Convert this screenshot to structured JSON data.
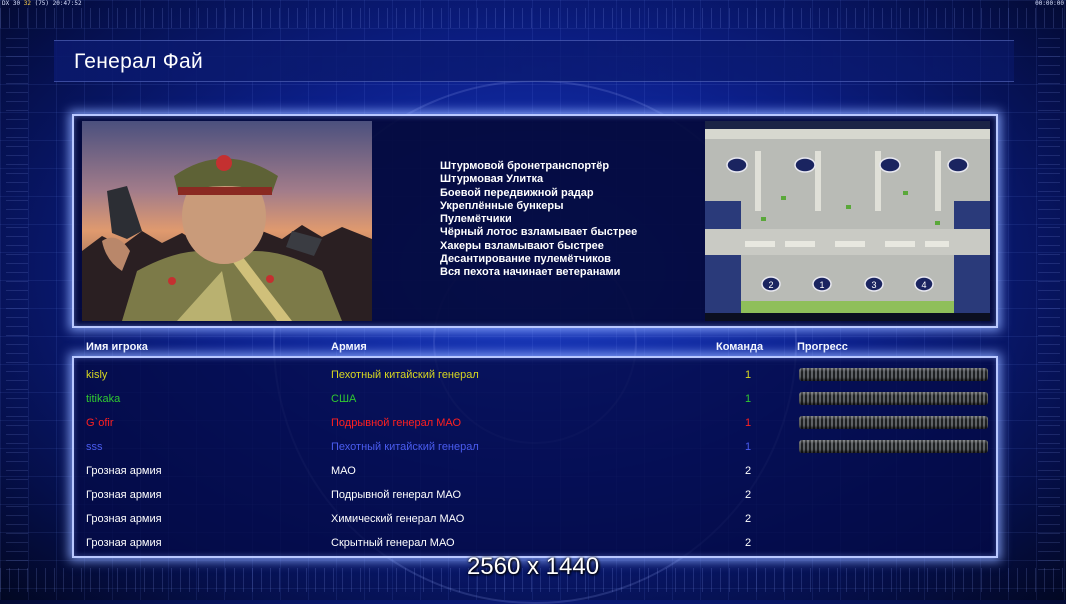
{
  "status_bar": {
    "left_a": "DX",
    "left_b": "30",
    "left_mid": "32",
    "left_c": "(75)",
    "left_time": "20:47:52",
    "right_time": "00:00:00"
  },
  "title": "Генерал Фай",
  "units": [
    "Штурмовой бронетранспортёр",
    "Штурмовая Улитка",
    "Боевой передвижной радар",
    "Укреплённые бункеры",
    "Пулемётчики",
    "Чёрный лотос взламывает быстрее",
    "Хакеры взламывают быстрее",
    "Десантирование пулемётчиков",
    "Вся пехота начинает ветеранами"
  ],
  "minimap": {
    "start_positions": [
      "2",
      "1",
      "3",
      "4"
    ]
  },
  "table": {
    "headers": {
      "player": "Имя игрока",
      "army": "Армия",
      "team": "Команда",
      "progress": "Прогресс"
    },
    "rows": [
      {
        "name": "kisly",
        "army": "Пехотный китайский генерал",
        "team": "1",
        "color": "#d8d820",
        "progress": 1.0
      },
      {
        "name": "titikaka",
        "army": "США",
        "team": "1",
        "color": "#30c830",
        "progress": 1.0
      },
      {
        "name": "G`ofir",
        "army": "Подрывной генерал МАО",
        "team": "1",
        "color": "#ff2020",
        "progress": 1.0
      },
      {
        "name": "sss",
        "army": "Пехотный китайский генерал",
        "team": "1",
        "color": "#4a5cf0",
        "progress": 1.0
      },
      {
        "name": "Грозная армия",
        "army": "МАО",
        "team": "2",
        "color": "#ffffff"
      },
      {
        "name": "Грозная армия",
        "army": "Подрывной генерал МАО",
        "team": "2",
        "color": "#ffffff"
      },
      {
        "name": "Грозная армия",
        "army": "Химический генерал МАО",
        "team": "2",
        "color": "#ffffff"
      },
      {
        "name": "Грозная армия",
        "army": "Скрытный генерал МАО",
        "team": "2",
        "color": "#ffffff"
      }
    ]
  },
  "watermark": "2560 x 1440"
}
